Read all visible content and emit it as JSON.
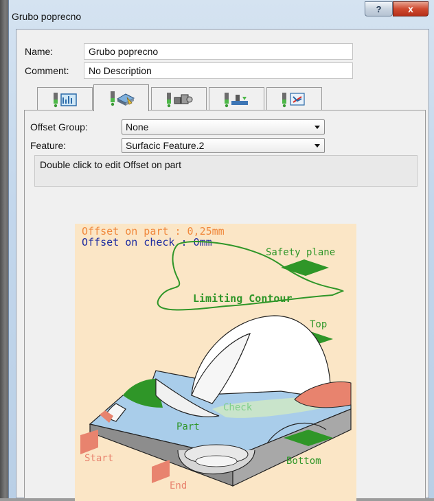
{
  "window": {
    "title": "Grubo poprecno",
    "help_label": "?",
    "close_label": "x"
  },
  "form": {
    "name_label": "Name:",
    "name_value": "Grubo poprecno",
    "comment_label": "Comment:",
    "comment_value": "No Description"
  },
  "tabs": [
    {
      "icon": "tool-geometry-icon",
      "active": false
    },
    {
      "icon": "part-geometry-icon",
      "active": true
    },
    {
      "icon": "tool-assembly-icon",
      "active": false
    },
    {
      "icon": "feeds-speeds-icon",
      "active": false
    },
    {
      "icon": "macros-icon",
      "active": false
    }
  ],
  "panel": {
    "offset_group_label": "Offset Group:",
    "offset_group_value": "None",
    "feature_label": "Feature:",
    "feature_value": "Surfacic Feature.2",
    "message": "Double click to edit Offset on part"
  },
  "diagram": {
    "offset_part_text": "Offset on part : 0,25mm",
    "offset_check_text": "Offset on check : 0mm",
    "safety_plane": "Safety plane",
    "limiting_contour": "Limiting Contour",
    "top": "Top",
    "check": "Check",
    "part": "Part",
    "start": "Start",
    "bottom": "Bottom",
    "end": "End",
    "colors": {
      "background": "#fbe6c6",
      "orange_text": "#f0883c",
      "blue_text": "#1c2aa0",
      "green": "#2f9628",
      "salmon": "#e8836e",
      "light_blue": "#a9cdea",
      "gray_block": "#9e9e9e"
    }
  }
}
